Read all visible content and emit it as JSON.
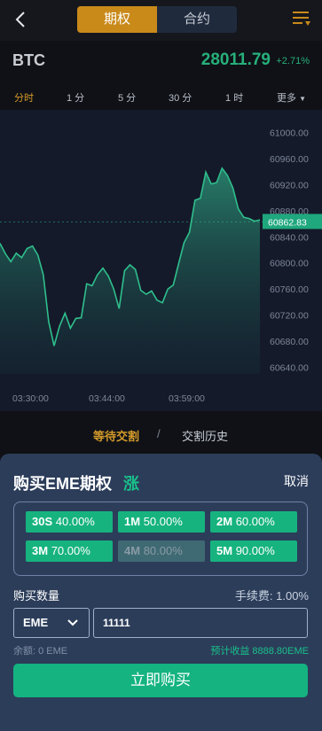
{
  "header": {
    "tabs": [
      {
        "label": "期权"
      },
      {
        "label": "合约"
      }
    ]
  },
  "ticker": {
    "pair": "BTC",
    "price": "28011.79",
    "change": "+2.71%"
  },
  "intervals": [
    {
      "label": "分时"
    },
    {
      "label": "1 分"
    },
    {
      "label": "5 分"
    },
    {
      "label": "30 分"
    },
    {
      "label": "1 时"
    },
    {
      "label": "更多"
    }
  ],
  "chart_data": {
    "type": "area",
    "y_ticks": [
      "61000.00",
      "60960.00",
      "60920.00",
      "60880.00",
      "60840.00",
      "60800.00",
      "60760.00",
      "60720.00",
      "60680.00",
      "60640.00"
    ],
    "x_ticks": [
      "03:30:00",
      "03:44:00",
      "03:59:00"
    ],
    "ylim": [
      60630,
      61010
    ],
    "current_label": "60862.83",
    "values": [
      60830,
      60814,
      60802,
      60815,
      60808,
      60822,
      60826,
      60812,
      60782,
      60710,
      60673,
      60703,
      60723,
      60700,
      60715,
      60716,
      60768,
      60765,
      60782,
      60792,
      60780,
      60760,
      60730,
      60788,
      60797,
      60790,
      60758,
      60752,
      60757,
      60743,
      60739,
      60760,
      60766,
      60799,
      60831,
      60847,
      60896,
      60899,
      60939,
      60921,
      60923,
      60945,
      60934,
      60915,
      60883,
      60870,
      60868,
      60864,
      60866
    ]
  },
  "lower_tabs": {
    "pending": "等待交割",
    "separator": "/",
    "history": "交割历史"
  },
  "panel": {
    "title": "购买EME期权",
    "direction": "涨",
    "cancel": "取消",
    "options": [
      {
        "code": "30S",
        "pct": "40.00%"
      },
      {
        "code": "1M",
        "pct": "50.00%"
      },
      {
        "code": "2M",
        "pct": "60.00%"
      },
      {
        "code": "3M",
        "pct": "70.00%"
      },
      {
        "code": "4M",
        "pct": "80.00%"
      },
      {
        "code": "5M",
        "pct": "90.00%"
      }
    ],
    "quantity_label": "购买数量",
    "fee": "手续费: 1.00%",
    "currency": "EME",
    "amount": "11111",
    "balance": "余额: 0 EME",
    "estimate": "预计收益 8888.80EME",
    "buy_label": "立即购买"
  },
  "colors": {
    "accent": "#c98a1a",
    "up": "#19c08a",
    "panel_bg": "#2c3d5a"
  }
}
